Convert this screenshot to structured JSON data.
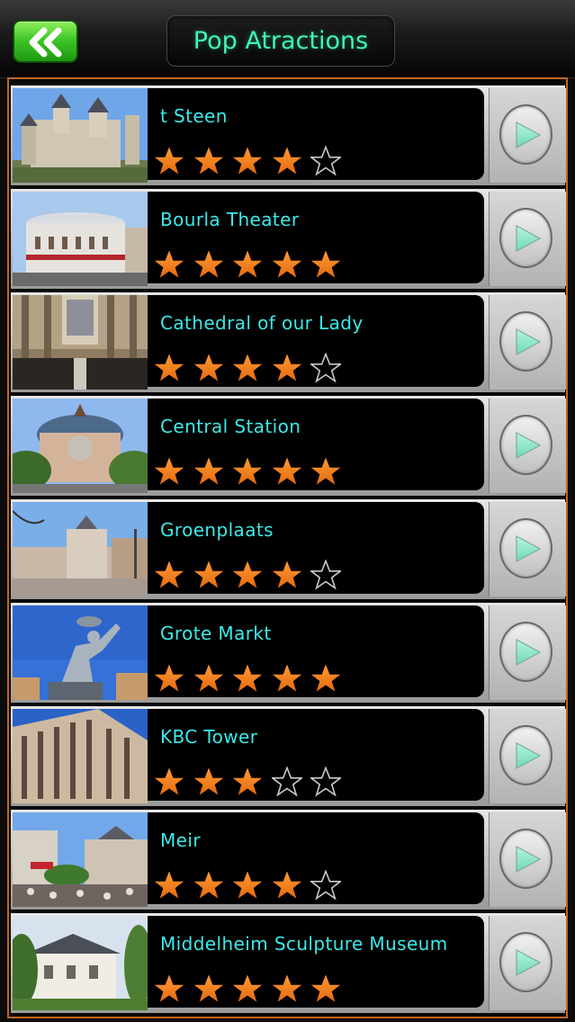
{
  "header": {
    "title": "Pop Atractions",
    "back_icon": "double-chevron-left-icon"
  },
  "colors": {
    "accent_cyan": "#3de9e9",
    "title_green": "#3ff5b8",
    "star_orange": "#f27b1c",
    "frame_orange": "#c3661e",
    "back_green": "#3fc628"
  },
  "attractions": [
    {
      "name": "t Steen",
      "rating": 4,
      "photo": "castle"
    },
    {
      "name": "Bourla Theater",
      "rating": 5,
      "photo": "theater"
    },
    {
      "name": "Cathedral of our Lady",
      "rating": 4,
      "photo": "church-interior"
    },
    {
      "name": "Central Station",
      "rating": 5,
      "photo": "station"
    },
    {
      "name": "Groenplaats",
      "rating": 4,
      "photo": "square"
    },
    {
      "name": "Grote Markt",
      "rating": 5,
      "photo": "statue"
    },
    {
      "name": "KBC Tower",
      "rating": 3,
      "photo": "tower"
    },
    {
      "name": "Meir",
      "rating": 4,
      "photo": "street"
    },
    {
      "name": "Middelheim Sculpture Museum",
      "rating": 5,
      "photo": "villa"
    }
  ]
}
